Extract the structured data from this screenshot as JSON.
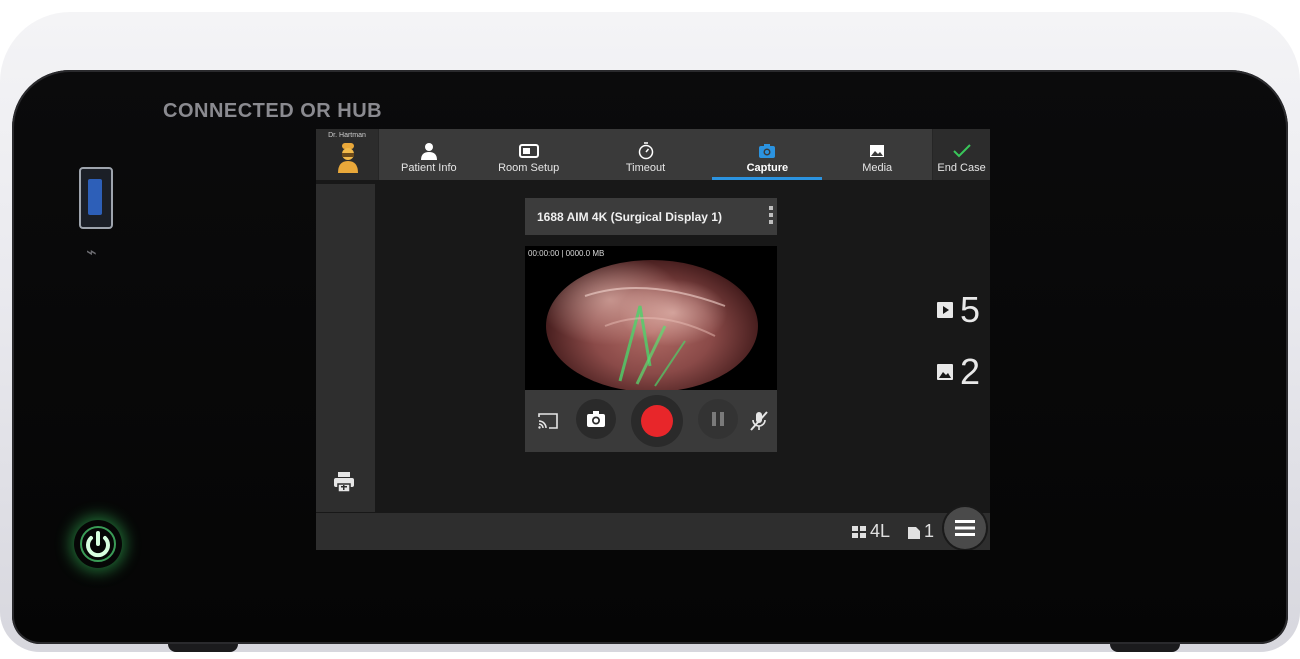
{
  "device": {
    "brand_label": "CONNECTED OR HUB"
  },
  "header": {
    "user_name": "Dr. Hartman",
    "tabs": [
      {
        "label": "Patient Info",
        "icon": "person-icon"
      },
      {
        "label": "Room Setup",
        "icon": "monitor-icon"
      },
      {
        "label": "Timeout",
        "icon": "timer-icon"
      },
      {
        "label": "Capture",
        "icon": "camera-icon",
        "active": true
      },
      {
        "label": "Media",
        "icon": "image-icon"
      },
      {
        "label": "End Case",
        "icon": "check-icon"
      }
    ]
  },
  "capture": {
    "source_title": "1688 AIM 4K (Surgical Display 1)",
    "recording_info": "00:00:00 | 0000.0 MB"
  },
  "counters": {
    "videos": "5",
    "images": "2"
  },
  "footer": {
    "layout_label": "4L",
    "page_label": "1"
  },
  "colors": {
    "accent": "#2b93e0",
    "record": "#e8262a",
    "check": "#39c75a",
    "power_led": "#46ff78"
  }
}
